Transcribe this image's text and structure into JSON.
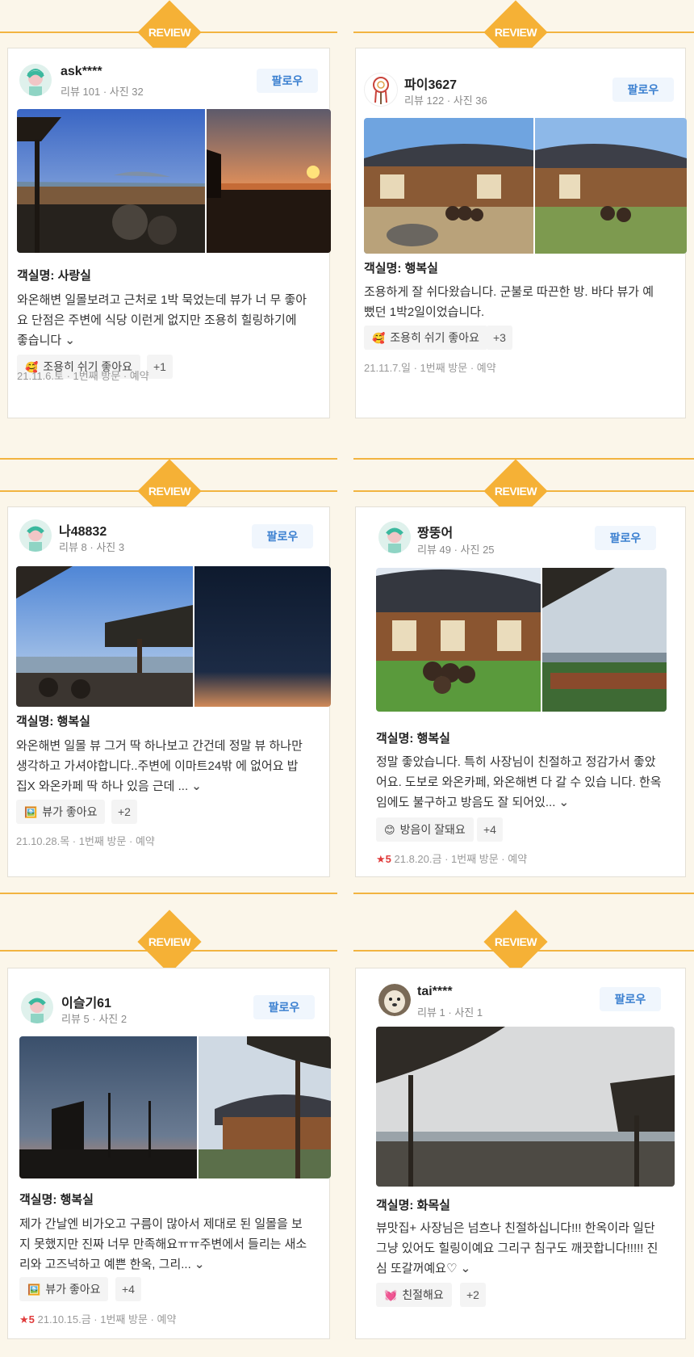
{
  "badge_label": "REVIEW",
  "follow_label": "팔로우",
  "star_icon": "★",
  "chevron_icon": "⌄",
  "reviews": [
    {
      "username": "ask****",
      "meta": "리뷰 101 · 사진 32",
      "avatar": "default-avatar",
      "room": "객실명: 사랑실",
      "text": "와온해변 일몰보려고 근처로 1박 묵었는데 뷰가 너 무 좋아요 단점은 주변에 식당 이런게 없지만 조용히 힐링하기에 좋습니다",
      "tag_emoji": "🥰",
      "tag": "조용히 쉬기 좋아요",
      "tag_more": "+1",
      "rating": "",
      "footer": "21.11.6.토 · 1번째 방문 · 예약"
    },
    {
      "username": "파이3627",
      "meta": "리뷰 122 · 사진 36",
      "avatar": "dreamcatcher-avatar",
      "room": "객실명: 행복실",
      "text": "조용하게 잘 쉬다왔습니다. 군불로 따끈한 방. 바다 뷰가 예뻤던 1박2일이었습니다.",
      "tag_emoji": "🥰",
      "tag": "조용히 쉬기 좋아요",
      "tag_more": "+3",
      "rating": "",
      "footer": "21.11.7.일 · 1번째 방문 · 예약"
    },
    {
      "username": "나48832",
      "meta": "리뷰 8 · 사진 3",
      "avatar": "default-avatar",
      "room": "객실명: 행복실",
      "text": "와온해변 일몰 뷰 그거 딱 하나보고 간건데 정말 뷰 하나만 생각하고 가셔야합니다..주변에 이마트24밖 에 없어요 밥집X 와온카페 딱 하나 있음 근데 ...",
      "tag_emoji": "🖼️",
      "tag": "뷰가 좋아요",
      "tag_more": "+2",
      "rating": "",
      "footer": "21.10.28.목 · 1번째 방문 · 예약"
    },
    {
      "username": "짱뚱어",
      "meta": "리뷰 49 · 사진 25",
      "avatar": "default-avatar",
      "room": "객실명: 행복실",
      "text": "정말 좋았습니다. 특히 사장님이 친절하고 정감가서 좋았어요. 도보로 와온카페, 와온해변 다 갈 수 있습 니다. 한옥임에도 불구하고 방음도 잘 되어있...",
      "tag_emoji": "😊",
      "tag": "방음이 잘돼요",
      "tag_more": "+4",
      "rating": "5",
      "footer": "21.8.20.금 · 1번째 방문 · 예약"
    },
    {
      "username": "이슬기61",
      "meta": "리뷰 5 · 사진 2",
      "avatar": "default-avatar",
      "room": "객실명: 행복실",
      "text": "제가 간날엔 비가오고 구름이 많아서 제대로 된 일몰을 보지 못했지만 진짜 너무 만족해요ㅠㅠ주변에서 들리는 새소리와 고즈넉하고 예쁜 한옥, 그리...",
      "tag_emoji": "🖼️",
      "tag": "뷰가 좋아요",
      "tag_more": "+4",
      "rating": "5",
      "footer": "21.10.15.금 · 1번째 방문 · 예약"
    },
    {
      "username": "tai****",
      "meta": "리뷰 1 · 사진 1",
      "avatar": "dog-avatar",
      "room": "객실명: 화목실",
      "text": "뷰맛집+ 사장님은 넘흐나 친절하십니다!!! 한옥이라 일단 그냥 있어도 힐링이예요 그리구 침구도 깨끗합니다!!!!! 진심 또갈꺼예요♡",
      "tag_emoji": "💓",
      "tag": "친절해요",
      "tag_more": "+2",
      "rating": "",
      "footer": ""
    }
  ]
}
